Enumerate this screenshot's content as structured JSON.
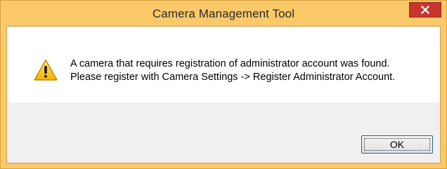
{
  "window": {
    "title": "Camera Management Tool"
  },
  "dialog": {
    "icon": "warning-icon",
    "message_lines": [
      "A camera that requires registration of administrator account was found.",
      "Please register with Camera Settings -> Register Administrator Account."
    ],
    "ok_label": "OK"
  },
  "colors": {
    "frame": "#fbc86a",
    "close_button": "#c7352c",
    "footer": "#f0f0f0",
    "warning_fill": "#f5c400"
  }
}
